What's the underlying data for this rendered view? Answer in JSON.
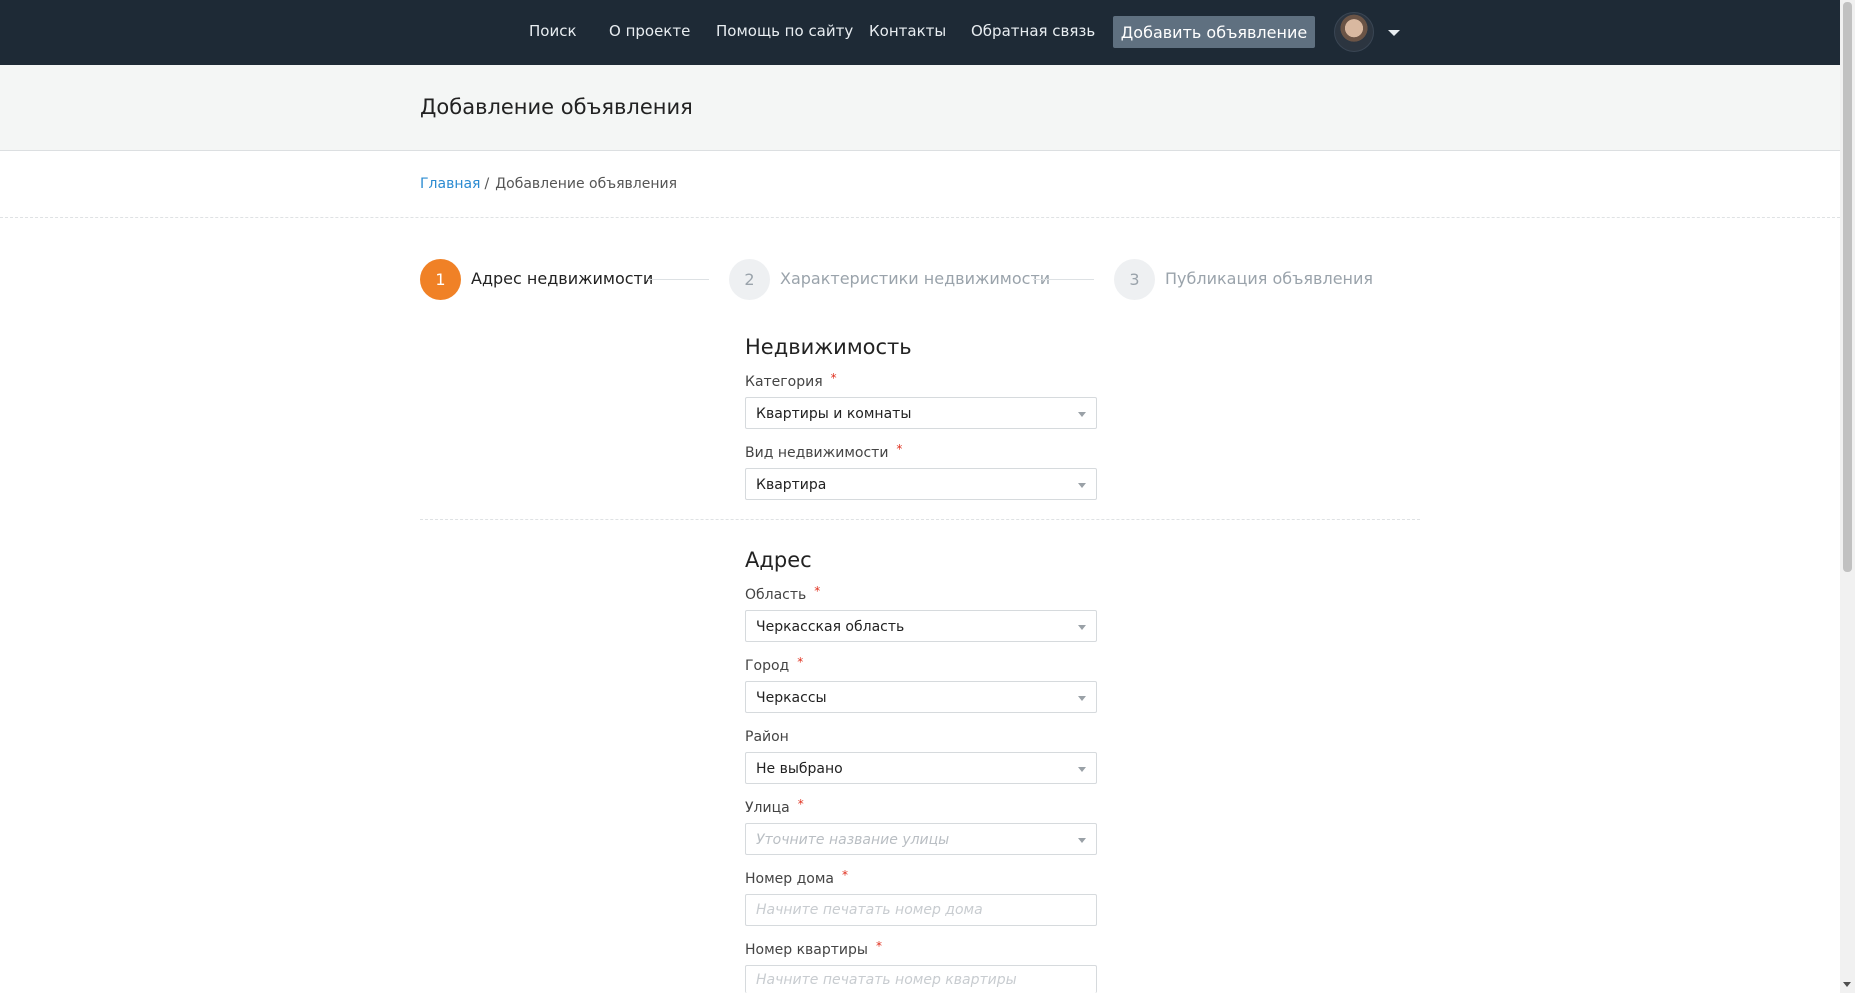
{
  "header": {
    "nav": [
      {
        "label": "Поиск"
      },
      {
        "label": "О проекте"
      },
      {
        "label": "Помощь по сайту"
      },
      {
        "label": "Контакты"
      },
      {
        "label": "Обратная связь"
      }
    ],
    "add_button_label": "Добавить объявление",
    "avatar_icon": "user-avatar",
    "menu_caret_icon": "caret-down-icon"
  },
  "page": {
    "title": "Добавление объявления"
  },
  "breadcrumb": {
    "home": "Главная",
    "separator": "/",
    "current": "Добавление объявления"
  },
  "steps": [
    {
      "number": "1",
      "label": "Адрес недвижимости",
      "state": "active"
    },
    {
      "number": "2",
      "label": "Характеристики недвижимости",
      "state": "inactive"
    },
    {
      "number": "3",
      "label": "Публикация объявления",
      "state": "inactive"
    }
  ],
  "sections": {
    "property": {
      "title": "Недвижимость",
      "category": {
        "label": "Категория",
        "required": "*",
        "value": "Квартиры и комнаты"
      },
      "type": {
        "label": "Вид недвижимости",
        "required": "*",
        "value": "Квартира"
      }
    },
    "address": {
      "title": "Адрес",
      "region": {
        "label": "Область",
        "required": "*",
        "value": "Черкасская область"
      },
      "city": {
        "label": "Город",
        "required": "*",
        "value": "Черкассы"
      },
      "district": {
        "label": "Район",
        "value": "Не выбрано"
      },
      "street": {
        "label": "Улица",
        "required": "*",
        "placeholder": "Уточните название улицы"
      },
      "house": {
        "label": "Номер дома",
        "required": "*",
        "placeholder": "Начните печатать номер дома"
      },
      "apartment": {
        "label": "Номер квартиры",
        "required": "*",
        "placeholder": "Начните печатать номер квартиры"
      }
    }
  },
  "colors": {
    "header_bg": "#1e2a36",
    "accent_step": "#f08126",
    "link": "#2b8bd1",
    "required": "#e0301e"
  }
}
